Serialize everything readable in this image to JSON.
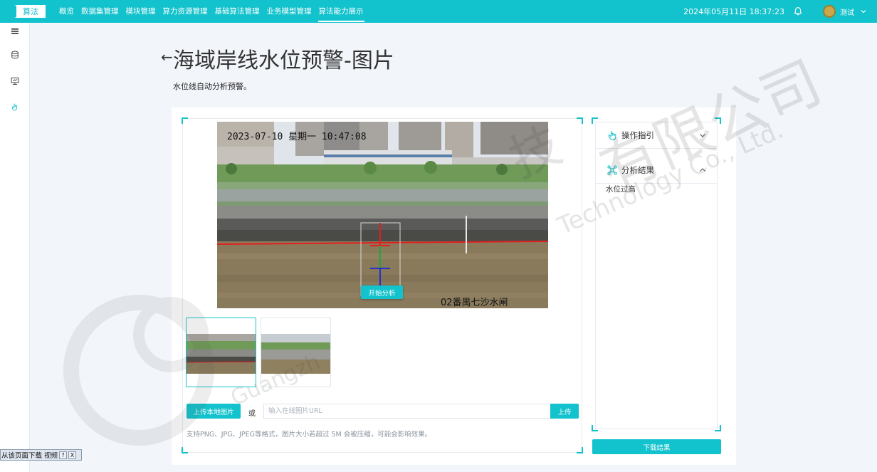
{
  "header": {
    "logo": "算法",
    "nav": [
      "概览",
      "数据集管理",
      "模块管理",
      "算力资源管理",
      "基础算法管理",
      "业务模型管理",
      "算法能力展示"
    ],
    "active_index": 6,
    "datetime": "2024年05月11日 18:37:23",
    "username": "测试",
    "bell_icon": "bell-icon",
    "chevron_icon": "chevron-down-icon"
  },
  "sidebar": {
    "icons": [
      "menu-icon",
      "database-icon",
      "monitor-icon",
      "pointer-icon"
    ]
  },
  "watermark": {
    "text": "有限公司",
    "latin": "Technology Co., Ltd.",
    "prefix": "Guangzh",
    "mid": "技"
  },
  "page": {
    "back_icon": "back-arrow-icon",
    "back_glyph": "←",
    "title": "海域岸线水位预警-图片",
    "description": "水位线自动分析预警。"
  },
  "image": {
    "timestamp": "2023-07-10 星期一 10:47:08",
    "location": "02番禺七沙水闸",
    "start_button": "开始分析"
  },
  "upload": {
    "local_button": "上传本地图片",
    "or": "或",
    "url_placeholder": "输入在线图片URL",
    "url_value": "",
    "url_button": "上传",
    "hint": "支持PNG、JPG、JPEG等格式，图片大小若超过 5M 会被压缩，可能会影响效果。"
  },
  "panel": {
    "guide_title": "操作指引",
    "result_title": "分析结果",
    "result_text": "水位过高",
    "download_button": "下载结果"
  },
  "float_bar": {
    "text": "从该页面下载 视频",
    "help": "?",
    "close": "X"
  },
  "colors": {
    "accent": "#12c2cc",
    "water": "#8a7a5c",
    "line_red": "#e02020",
    "line_green": "#27a33a",
    "line_blue": "#2430c8"
  }
}
